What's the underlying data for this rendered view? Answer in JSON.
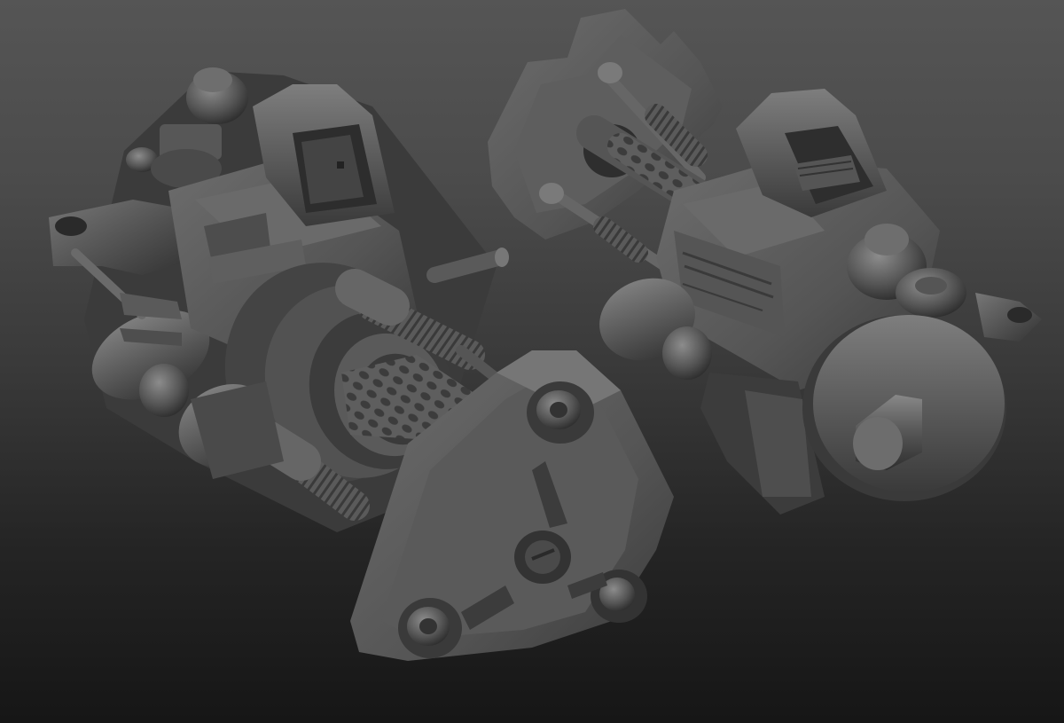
{
  "scene": {
    "colors": {
      "bg_top": "#555555",
      "bg_bottom": "#161616",
      "material_light": "#8a8a8a",
      "material_mid": "#5e5e5e",
      "material_dark": "#3a3a3a",
      "material_shadow": "#242424"
    },
    "objects": [
      {
        "name": "left-gun-model"
      },
      {
        "name": "right-gun-model"
      }
    ]
  }
}
